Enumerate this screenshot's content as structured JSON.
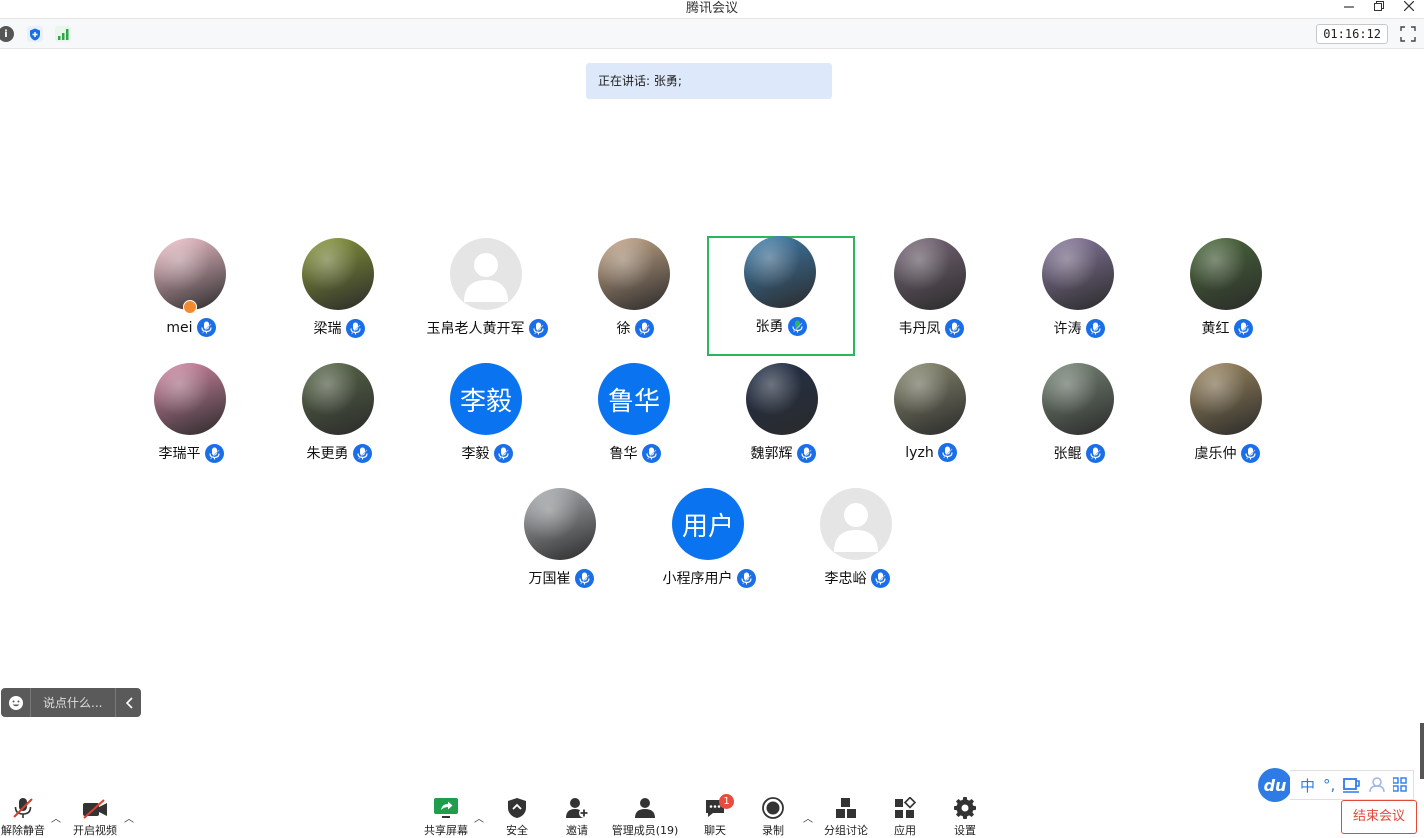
{
  "window": {
    "title": "腾讯会议"
  },
  "toolbar": {
    "timer": "01:16:12"
  },
  "speaking": {
    "text": "正在讲话: 张勇;"
  },
  "participants": [
    {
      "name": "mei",
      "avatar": "photo",
      "color": "#f7c6d0",
      "host": true
    },
    {
      "name": "梁瑞",
      "avatar": "photo",
      "color": "#8a9a3a"
    },
    {
      "name": "玉帛老人黄开军",
      "avatar": "default"
    },
    {
      "name": "徐",
      "avatar": "photo",
      "color": "#c9a98a"
    },
    {
      "name": "张勇",
      "avatar": "photo",
      "color": "#3f7fb0",
      "speaking": true
    },
    {
      "name": "韦丹凤",
      "avatar": "photo",
      "color": "#7a6a7a"
    },
    {
      "name": "许涛",
      "avatar": "photo",
      "color": "#8a7aa0"
    },
    {
      "name": "黄红",
      "avatar": "photo",
      "color": "#4a6a3a"
    },
    {
      "name": "李瑞平",
      "avatar": "photo",
      "color": "#d88aa8"
    },
    {
      "name": "朱更勇",
      "avatar": "photo",
      "color": "#5a6a4a"
    },
    {
      "name": "李毅",
      "avatar": "text",
      "initials": "李毅"
    },
    {
      "name": "鲁华",
      "avatar": "text",
      "initials": "鲁华"
    },
    {
      "name": "魏郭辉",
      "avatar": "photo",
      "color": "#22304a"
    },
    {
      "name": "lyzh",
      "avatar": "photo",
      "color": "#8a8a70"
    },
    {
      "name": "张鲲",
      "avatar": "photo",
      "color": "#7a8a7a"
    },
    {
      "name": "虞乐仲",
      "avatar": "photo",
      "color": "#a08a60"
    },
    {
      "name": "万国崔",
      "avatar": "photo",
      "color": "#b0b4b8"
    },
    {
      "name": "小程序用户",
      "avatar": "text",
      "initials": "用户"
    },
    {
      "name": "李忠峪",
      "avatar": "default"
    }
  ],
  "chat": {
    "placeholder": "说点什么..."
  },
  "bottombar": {
    "unmute": "解除静音",
    "start_video": "开启视频",
    "share_screen": "共享屏幕",
    "security": "安全",
    "invite": "邀请",
    "manage_members": "管理成员(19)",
    "chat": "聊天",
    "chat_badge": "1",
    "record": "录制",
    "breakout": "分组讨论",
    "apps": "应用",
    "settings": "设置",
    "end_meeting": "结束会议"
  },
  "ime": {
    "logo": "du",
    "mode": "中",
    "punct": "°,"
  },
  "colors": {
    "accent": "#0a73f0",
    "speaking_border": "#2db55d",
    "end": "#e04a3a"
  }
}
